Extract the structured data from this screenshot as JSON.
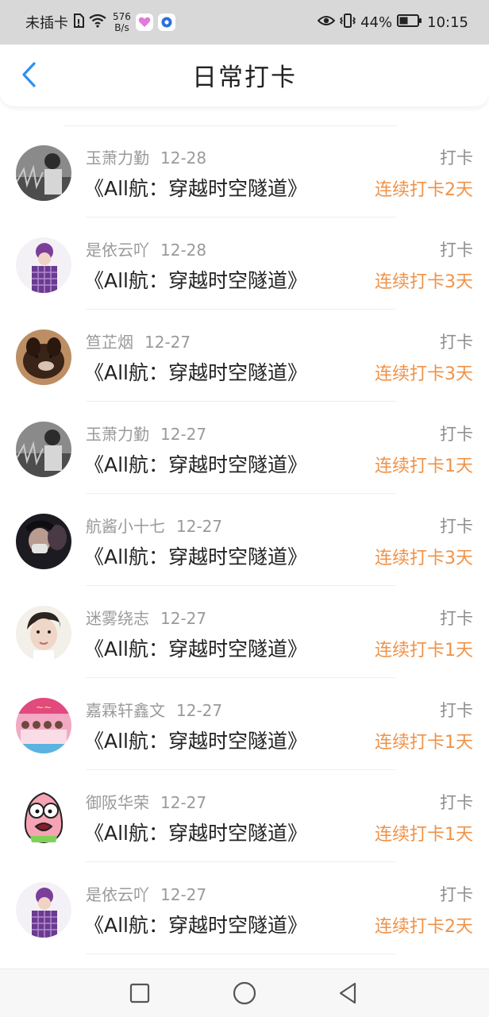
{
  "statusbar": {
    "carrier": "未插卡",
    "speed_value": "576",
    "speed_unit": "B/s",
    "battery": "44%",
    "time": "10:15"
  },
  "header": {
    "title": "日常打卡"
  },
  "checkins": [
    {
      "user": "玉萧力勤",
      "date": "12-28",
      "book": "《All航：穿越时空隧道》",
      "action": "打卡",
      "streak": "连续打卡2天",
      "avatar": "gray-boy"
    },
    {
      "user": "是依云吖",
      "date": "12-28",
      "book": "《All航：穿越时空隧道》",
      "action": "打卡",
      "streak": "连续打卡3天",
      "avatar": "purple-plaid"
    },
    {
      "user": "笪芷烟",
      "date": "12-27",
      "book": "《All航：穿越时空隧道》",
      "action": "打卡",
      "streak": "连续打卡3天",
      "avatar": "dog"
    },
    {
      "user": "玉萧力勤",
      "date": "12-27",
      "book": "《All航：穿越时空隧道》",
      "action": "打卡",
      "streak": "连续打卡1天",
      "avatar": "gray-boy"
    },
    {
      "user": "航酱小十七",
      "date": "12-27",
      "book": "《All航：穿越时空隧道》",
      "action": "打卡",
      "streak": "连续打卡3天",
      "avatar": "dark-mask"
    },
    {
      "user": "迷雾绕志",
      "date": "12-27",
      "book": "《All航：穿越时空隧道》",
      "action": "打卡",
      "streak": "连续打卡1天",
      "avatar": "boy-face"
    },
    {
      "user": "嘉霖轩鑫文",
      "date": "12-27",
      "book": "《All航：穿越时空隧道》",
      "action": "打卡",
      "streak": "连续打卡1天",
      "avatar": "pink-group"
    },
    {
      "user": "御阪华荣",
      "date": "12-27",
      "book": "《All航：穿越时空隧道》",
      "action": "打卡",
      "streak": "连续打卡1天",
      "avatar": "patrick-cartoon"
    },
    {
      "user": "是依云吖",
      "date": "12-27",
      "book": "《All航：穿越时空隧道》",
      "action": "打卡",
      "streak": "连续打卡2天",
      "avatar": "purple-plaid"
    }
  ],
  "colors": {
    "accent": "#2e8ff0",
    "streak": "#f09247",
    "muted": "#9a9a9a"
  },
  "icons": {
    "back": "chevron-left-icon",
    "nav_recent": "square-icon",
    "nav_home": "circle-icon",
    "nav_back": "triangle-back-icon"
  }
}
